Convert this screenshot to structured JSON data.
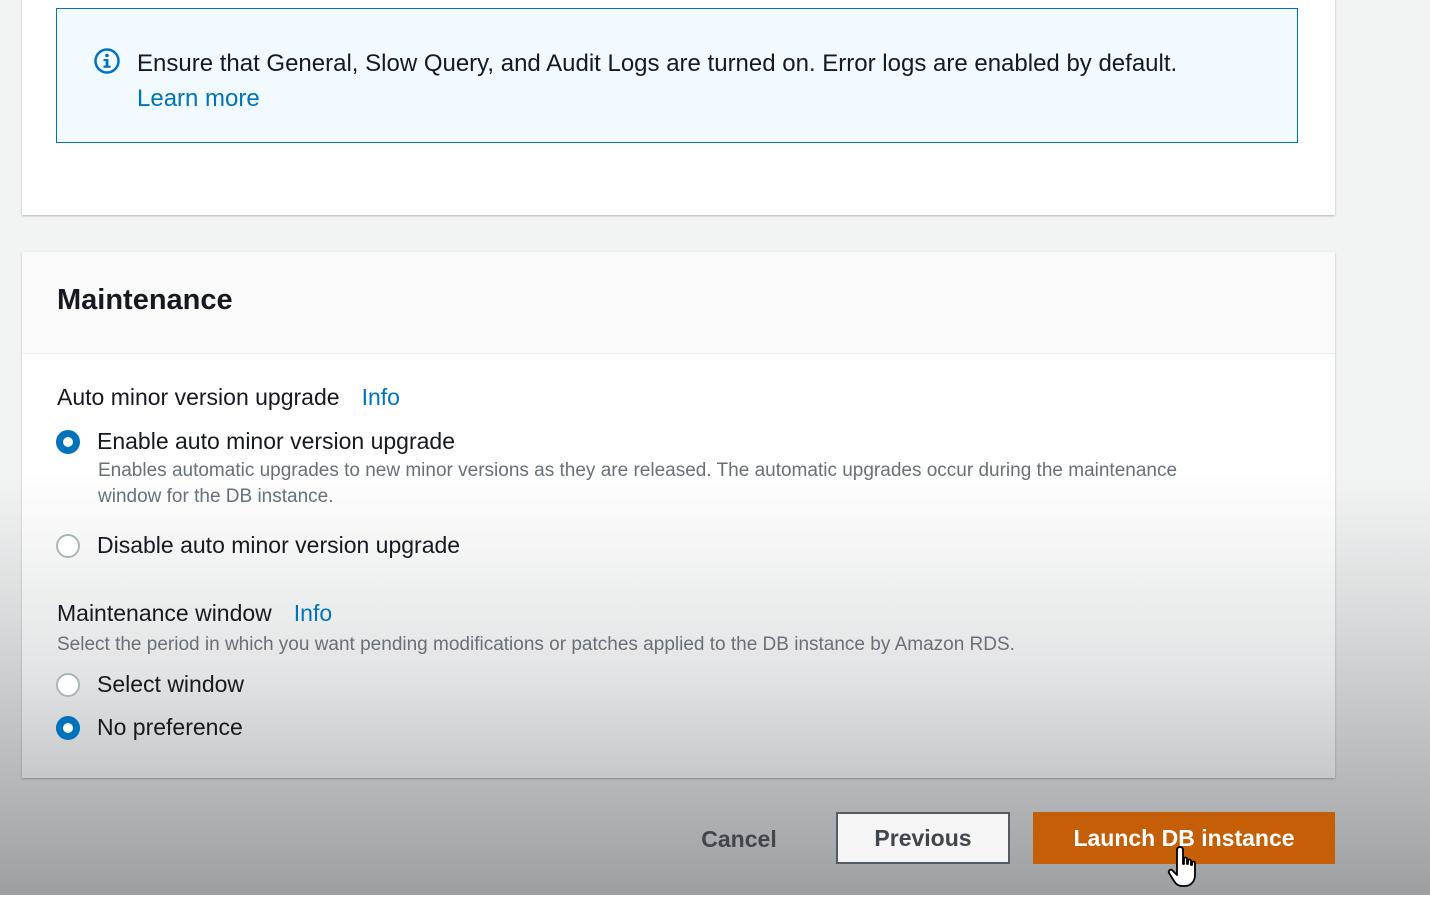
{
  "logging_alert": {
    "icon": "info-circle-icon",
    "message": "Ensure that General, Slow Query, and Audit Logs are turned on. Error logs are enabled by default.",
    "link": "Learn more"
  },
  "maintenance": {
    "title": "Maintenance",
    "auto_minor_upgrade": {
      "label": "Auto minor version upgrade",
      "info": "Info",
      "options": [
        {
          "label": "Enable auto minor version upgrade",
          "description_line1": "Enables automatic upgrades to new minor versions as they are released. The automatic upgrades occur during the maintenance",
          "description_line2": "window for the DB instance.",
          "selected": true
        },
        {
          "label": "Disable auto minor version upgrade",
          "selected": false
        }
      ]
    },
    "maintenance_window": {
      "label": "Maintenance window",
      "info": "Info",
      "description": "Select the period in which you want pending modifications or patches applied to the DB instance by Amazon RDS.",
      "options": [
        {
          "label": "Select window",
          "selected": false
        },
        {
          "label": "No preference",
          "selected": true
        }
      ]
    }
  },
  "footer": {
    "cancel": "Cancel",
    "previous": "Previous",
    "launch": "Launch DB instance"
  },
  "colors": {
    "accent": "#0073bb",
    "primary_button": "#c45f07"
  }
}
